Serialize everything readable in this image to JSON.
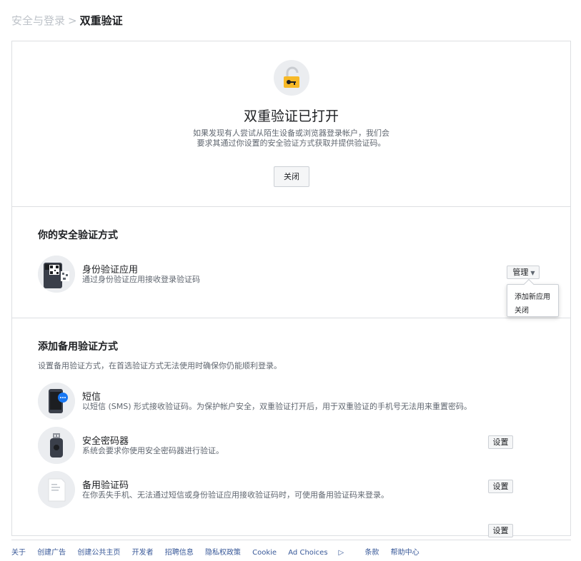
{
  "breadcrumb": {
    "parent": "安全与登录",
    "separator": ">",
    "current": "双重验证"
  },
  "hero": {
    "icon": "padlock-key-icon",
    "title": "双重验证已打开",
    "description": "如果发现有人尝试从陌生设备或浏览器登录帐户，我们会要求其通过你设置的安全验证方式获取并提供验证码。",
    "button_label": "关闭"
  },
  "security_methods": {
    "title": "你的安全验证方式",
    "items": [
      {
        "icon": "qr-code-phone-icon",
        "title": "身份验证应用",
        "description": "通过身份验证应用接收登录验证码",
        "action_label": "管理",
        "dropdown": [
          "添加新应用",
          "关闭"
        ]
      }
    ]
  },
  "backup_methods": {
    "title": "添加备用验证方式",
    "subtitle": "设置备用验证方式，在首选验证方式无法使用时确保你仍能顺利登录。",
    "items": [
      {
        "icon": "sms-phone-icon",
        "title": "短信",
        "description": "以短信 (SMS) 形式接收验证码。为保护帐户安全，双重验证打开后，用于双重验证的手机号无法用来重置密码。",
        "action_label": "设置"
      },
      {
        "icon": "security-key-icon",
        "title": "安全密码器",
        "description": "系统会要求你使用安全密码器进行验证。",
        "action_label": "设置"
      },
      {
        "icon": "backup-code-document-icon",
        "title": "备用验证码",
        "description": "在你丢失手机、无法通过短信或身份验证应用接收验证码时，可使用备用验证码来登录。",
        "action_label": "设置"
      }
    ]
  },
  "footer": {
    "links": [
      "关于",
      "创建广告",
      "创建公共主页",
      "开发者",
      "招聘信息",
      "隐私权政策",
      "Cookie",
      "Ad Choices",
      "条款",
      "帮助中心"
    ]
  },
  "colors": {
    "accent_yellow": "#f7b928",
    "link": "#385898",
    "border": "#dddfe2",
    "secondary_text": "#606770"
  }
}
